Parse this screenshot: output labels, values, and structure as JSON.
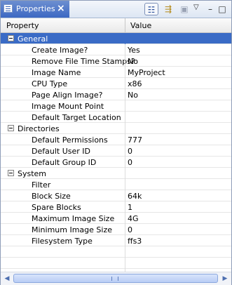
{
  "window": {
    "title": "Properties"
  },
  "columns": {
    "property": "Property",
    "value": "Value"
  },
  "toolbar": {
    "icons": [
      "show-categories-icon",
      "show-advanced-icon",
      "restore-default-icon",
      "view-menu-icon",
      "minimize-icon",
      "maximize-icon"
    ]
  },
  "groups": [
    {
      "label": "General",
      "expanded": true,
      "selected": true,
      "rows": [
        {
          "label": "Create Image?",
          "value": "Yes"
        },
        {
          "label": "Remove File Time Stamps?",
          "value": "No"
        },
        {
          "label": "Image Name",
          "value": "MyProject"
        },
        {
          "label": "CPU Type",
          "value": "x86"
        },
        {
          "label": "Page Align Image?",
          "value": "No"
        },
        {
          "label": "Image Mount Point",
          "value": ""
        },
        {
          "label": "Default Target Location",
          "value": ""
        }
      ]
    },
    {
      "label": "Directories",
      "expanded": true,
      "rows": [
        {
          "label": "Default Permissions",
          "value": "777"
        },
        {
          "label": "Default User ID",
          "value": "0"
        },
        {
          "label": "Default Group ID",
          "value": "0"
        }
      ]
    },
    {
      "label": "System",
      "expanded": true,
      "rows": [
        {
          "label": "Filter",
          "value": ""
        },
        {
          "label": "Block Size",
          "value": "64k"
        },
        {
          "label": "Spare Blocks",
          "value": "1"
        },
        {
          "label": "Maximum Image Size",
          "value": "4G"
        },
        {
          "label": "Minimum Image Size",
          "value": "0"
        },
        {
          "label": "Filesystem Type",
          "value": "ffs3"
        }
      ]
    }
  ]
}
